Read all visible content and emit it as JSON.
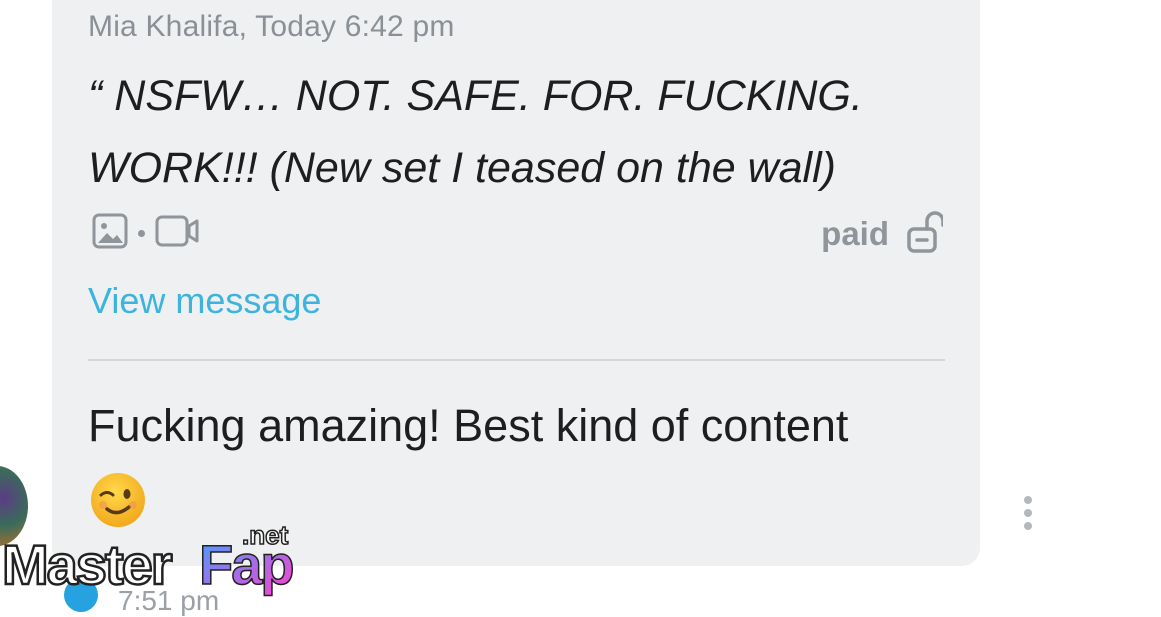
{
  "message": {
    "sender": "Mia Khalifa, Today 6:42 pm",
    "text": "“ NSFW… NOT. SAFE. FOR. FUCKING. WORK!!! (New set I teased on the wall)",
    "media_icons": [
      "image-icon",
      "video-icon"
    ],
    "paid_label": "paid",
    "paid_icon": "unlocked-lock-icon",
    "view_label": "View message"
  },
  "reply": {
    "text": "Fucking amazing! Best kind of content",
    "emoji": "winking-face-emoji"
  },
  "next_message": {
    "time": "7:51 pm"
  },
  "watermark": {
    "text_part1": "Master",
    "text_part2": "Fap",
    "suffix": ".net"
  },
  "colors": {
    "bubble": "#eef0f1",
    "link": "#3cb4dd",
    "muted": "#8f959a",
    "text": "#1e1e1e"
  }
}
